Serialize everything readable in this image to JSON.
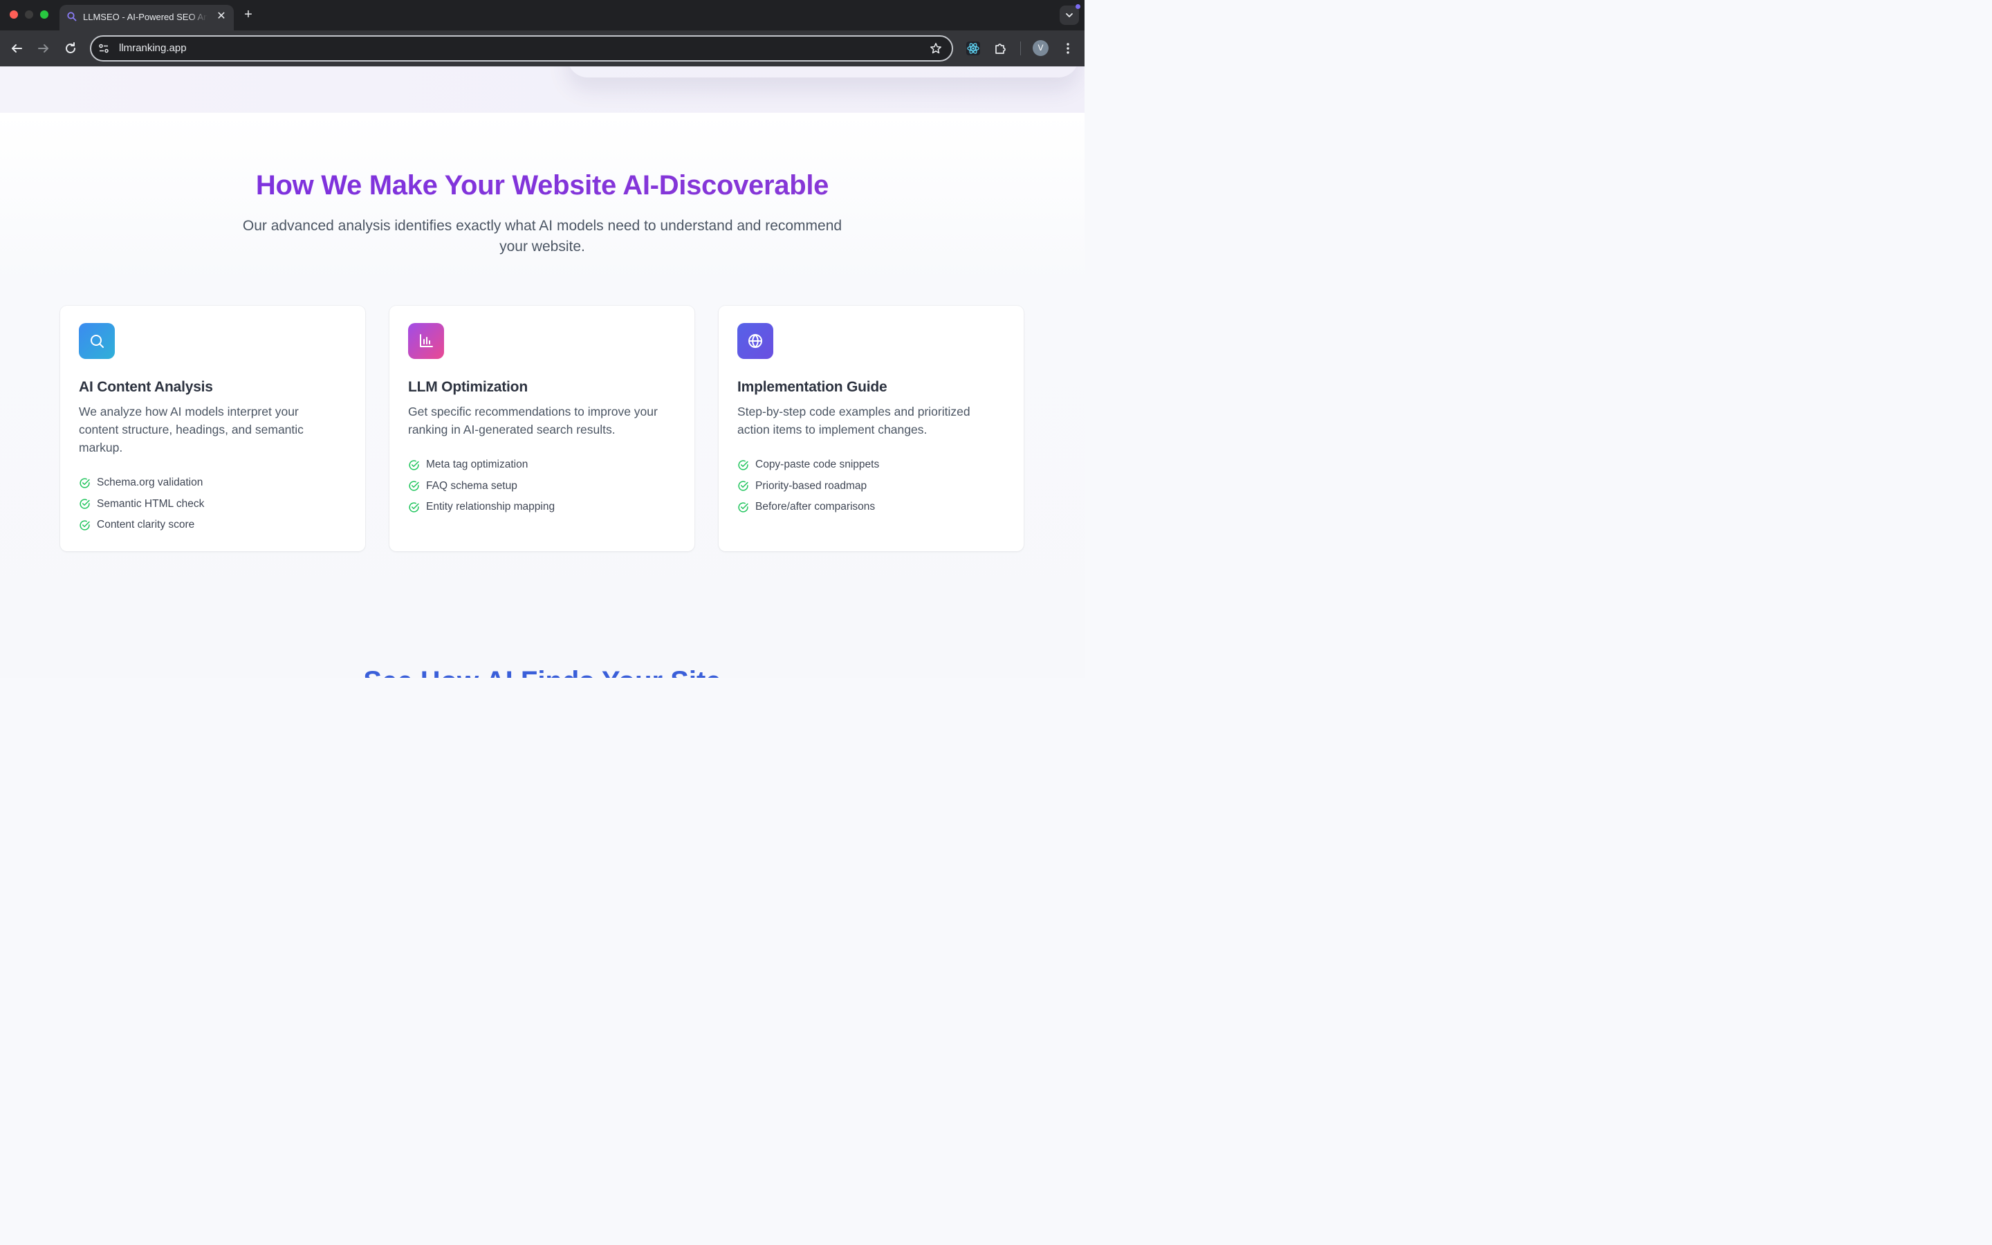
{
  "browser": {
    "tab_title": "LLMSEO - AI-Powered SEO Analysis",
    "new_tab_label": "+",
    "close_tab_label": "✕",
    "url": "llmranking.app",
    "profile_initial": "V"
  },
  "section": {
    "heading": "How We Make Your Website AI-Discoverable",
    "subheading": "Our advanced analysis identifies exactly what AI models need to understand and recommend your website.",
    "cards": [
      {
        "icon": "search-icon",
        "title": "AI Content Analysis",
        "description": "We analyze how AI models interpret your content structure, headings, and semantic markup.",
        "features": [
          "Schema.org validation",
          "Semantic HTML check",
          "Content clarity score"
        ]
      },
      {
        "icon": "bar-chart-icon",
        "title": "LLM Optimization",
        "description": "Get specific recommendations to improve your ranking in AI-generated search results.",
        "features": [
          "Meta tag optimization",
          "FAQ schema setup",
          "Entity relationship mapping"
        ]
      },
      {
        "icon": "globe-icon",
        "title": "Implementation Guide",
        "description": "Step-by-step code examples and prioritized action items to implement changes.",
        "features": [
          "Copy-paste code snippets",
          "Priority-based roadmap",
          "Before/after comparisons"
        ]
      }
    ],
    "next_heading": "See How AI Finds Your Site"
  },
  "colors": {
    "heading_purple": "#7b35d9",
    "check_green": "#22c55e",
    "next_heading_blue": "#3a5fd9"
  }
}
